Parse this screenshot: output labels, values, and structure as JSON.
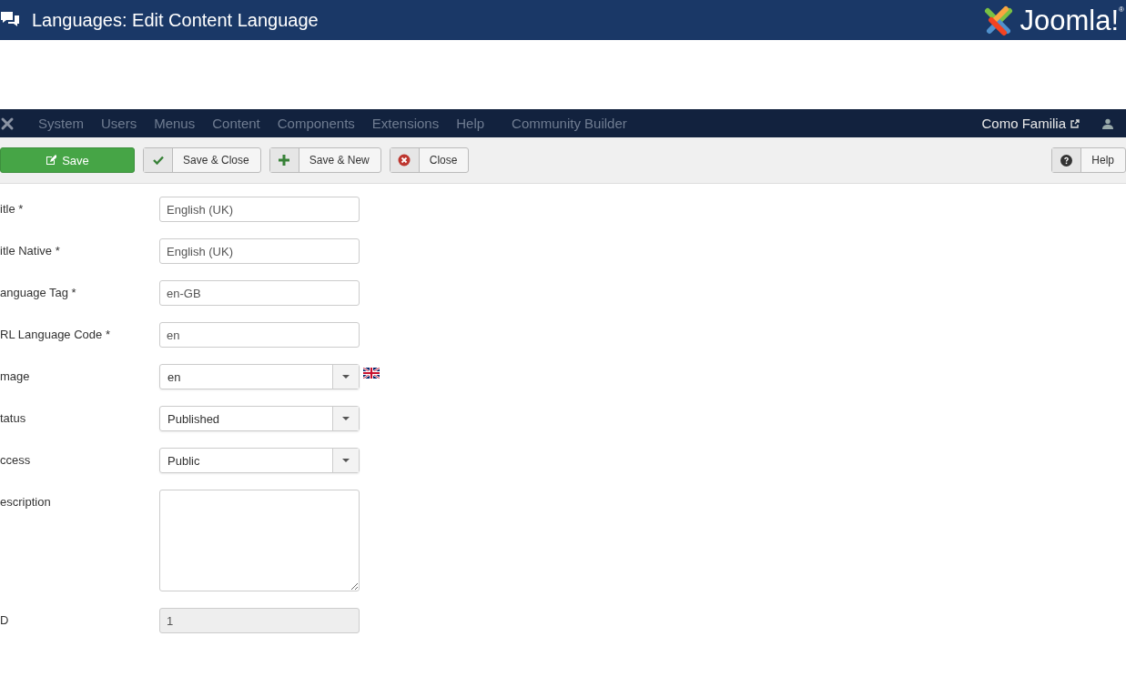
{
  "header": {
    "title": "Languages: Edit Content Language",
    "logo_text": "Joomla!",
    "logo_mark": "®"
  },
  "navbar": {
    "items": [
      {
        "label": "System"
      },
      {
        "label": "Users"
      },
      {
        "label": "Menus"
      },
      {
        "label": "Content"
      },
      {
        "label": "Components"
      },
      {
        "label": "Extensions"
      },
      {
        "label": "Help"
      },
      {
        "label": "Community Builder"
      }
    ],
    "site_link": "Como Familia"
  },
  "toolbar": {
    "buttons": [
      {
        "kind": "save",
        "label": "Save"
      },
      {
        "kind": "apply",
        "label": "Save & Close"
      },
      {
        "kind": "new",
        "label": "Save & New"
      },
      {
        "kind": "cancel",
        "label": "Close"
      }
    ],
    "help": {
      "label": "Help"
    }
  },
  "fields": [
    {
      "kind": "text",
      "label": "itle *",
      "value": "English (UK)"
    },
    {
      "kind": "text",
      "label": "itle Native *",
      "value": "English (UK)"
    },
    {
      "kind": "text",
      "label": "anguage Tag *",
      "value": "en-GB"
    },
    {
      "kind": "text",
      "label": "RL Language Code *",
      "value": "en"
    },
    {
      "kind": "select",
      "label": "mage",
      "value": "en",
      "flag": true
    },
    {
      "kind": "select",
      "label": "tatus",
      "value": "Published"
    },
    {
      "kind": "select",
      "label": "ccess",
      "value": "Public"
    },
    {
      "kind": "textarea",
      "label": "escription"
    },
    {
      "kind": "readonly",
      "label": "D",
      "value": "1"
    }
  ]
}
